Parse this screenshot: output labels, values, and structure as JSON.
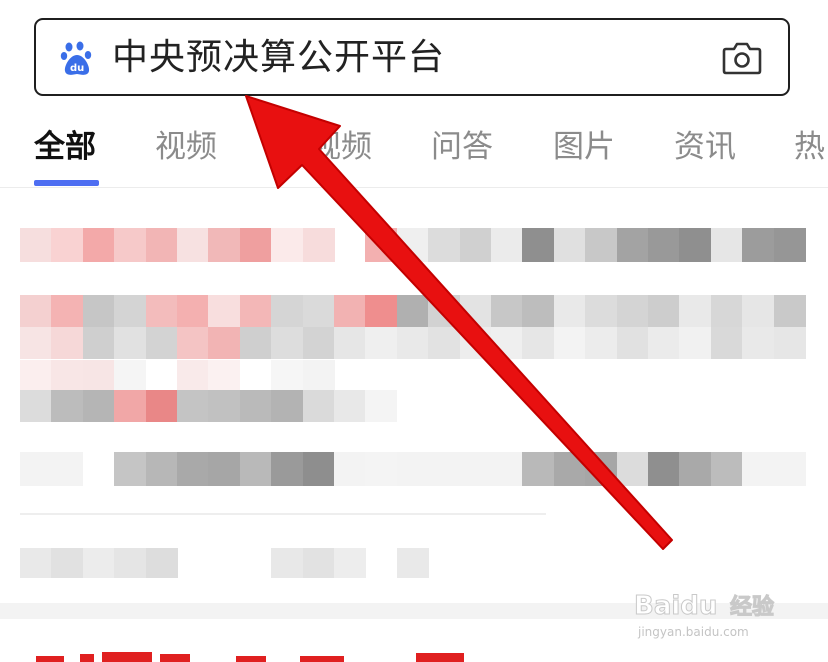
{
  "search": {
    "query": "中央预决算公开平台",
    "logo_icon": "baidu-paw-icon",
    "camera_icon": "camera-icon"
  },
  "tabs": [
    {
      "label": "全部",
      "active": true
    },
    {
      "label": "视频",
      "active": false
    },
    {
      "label": "视频",
      "active": false
    },
    {
      "label": "问答",
      "active": false
    },
    {
      "label": "图片",
      "active": false
    },
    {
      "label": "资讯",
      "active": false
    },
    {
      "label": "热",
      "active": false
    }
  ],
  "watermark": {
    "brand": "Baidu",
    "suffix": "经验",
    "url": "jingyan.baidu.com"
  },
  "colors": {
    "accent": "#4e6ef2",
    "arrow": "#e81010"
  }
}
